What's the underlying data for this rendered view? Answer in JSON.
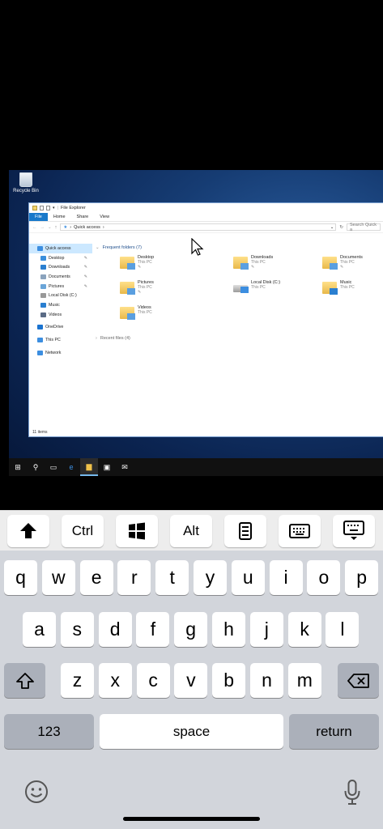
{
  "desktop": {
    "recycle_bin_label": "Recycle Bin"
  },
  "explorer": {
    "title": "File Explorer",
    "ribbon_tabs": [
      "File",
      "Home",
      "Share",
      "View"
    ],
    "breadcrumb": "Quick access",
    "search_placeholder": "Search Quick a",
    "nav_items": [
      {
        "label": "Quick access",
        "icon": "star-icon",
        "color": "#3c8ee0",
        "pinned": false
      },
      {
        "label": "Desktop",
        "icon": "desktop-icon",
        "color": "#3a8fdc",
        "pinned": true
      },
      {
        "label": "Downloads",
        "icon": "download-icon",
        "color": "#2a7fd0",
        "pinned": true
      },
      {
        "label": "Documents",
        "icon": "document-icon",
        "color": "#8aa3bd",
        "pinned": true
      },
      {
        "label": "Pictures",
        "icon": "pictures-icon",
        "color": "#6aa5d8",
        "pinned": true
      },
      {
        "label": "Local Disk (C:)",
        "icon": "disk-icon",
        "color": "#999999",
        "pinned": false
      },
      {
        "label": "Music",
        "icon": "music-icon",
        "color": "#2a7fd0",
        "pinned": false
      },
      {
        "label": "Videos",
        "icon": "video-icon",
        "color": "#5a6b85",
        "pinned": false
      },
      {
        "label": "OneDrive",
        "icon": "cloud-icon",
        "color": "#1a73d0",
        "pinned": false
      },
      {
        "label": "This PC",
        "icon": "computer-icon",
        "color": "#3c8ee0",
        "pinned": false
      },
      {
        "label": "Network",
        "icon": "network-icon",
        "color": "#3c8ee0",
        "pinned": false
      }
    ],
    "frequent_header": "Frequent folders (7)",
    "recent_header": "Recent files (4)",
    "folders": [
      {
        "name": "Desktop",
        "sub": "This PC",
        "badge": "desktop-icon",
        "pin": true
      },
      {
        "name": "Downloads",
        "sub": "This PC",
        "badge": "download-icon",
        "pin": true
      },
      {
        "name": "Documents",
        "sub": "This PC",
        "badge": "document-icon",
        "pin": true
      },
      {
        "name": "Pictures",
        "sub": "This PC",
        "badge": "pictures-icon",
        "pin": true
      },
      {
        "name": "Local Disk (C:)",
        "sub": "This PC",
        "badge": "disk-icon",
        "pin": false
      },
      {
        "name": "Music",
        "sub": "This PC",
        "badge": "music-icon",
        "pin": false
      },
      {
        "name": "Videos",
        "sub": "This PC",
        "badge": "video-icon",
        "pin": false
      }
    ],
    "status": "11 items",
    "pin_glyph": "✎"
  },
  "taskbar": {
    "items": [
      "start-icon",
      "search-icon",
      "task-view-icon",
      "edge-icon",
      "file-explorer-icon",
      "store-icon",
      "mail-icon"
    ],
    "active": "file-explorer-icon"
  },
  "toolbar": {
    "keys": [
      {
        "name": "shift-key-button",
        "label": "",
        "icon": "up-arrow-icon"
      },
      {
        "name": "ctrl-key-button",
        "label": "Ctrl",
        "icon": ""
      },
      {
        "name": "windows-key-button",
        "label": "",
        "icon": "windows-logo-icon"
      },
      {
        "name": "alt-key-button",
        "label": "Alt",
        "icon": ""
      },
      {
        "name": "function-keys-button",
        "label": "",
        "icon": "keypad-icon"
      },
      {
        "name": "keyboard-button",
        "label": "",
        "icon": "keyboard-icon"
      },
      {
        "name": "hide-keyboard-button",
        "label": "",
        "icon": "keyboard-hide-icon"
      }
    ]
  },
  "keyboard": {
    "row1": [
      "q",
      "w",
      "e",
      "r",
      "t",
      "y",
      "u",
      "i",
      "o",
      "p"
    ],
    "row2": [
      "a",
      "s",
      "d",
      "f",
      "g",
      "h",
      "j",
      "k",
      "l"
    ],
    "row3": [
      "z",
      "x",
      "c",
      "v",
      "b",
      "n",
      "m"
    ],
    "numbers_label": "123",
    "space_label": "space",
    "return_label": "return"
  }
}
